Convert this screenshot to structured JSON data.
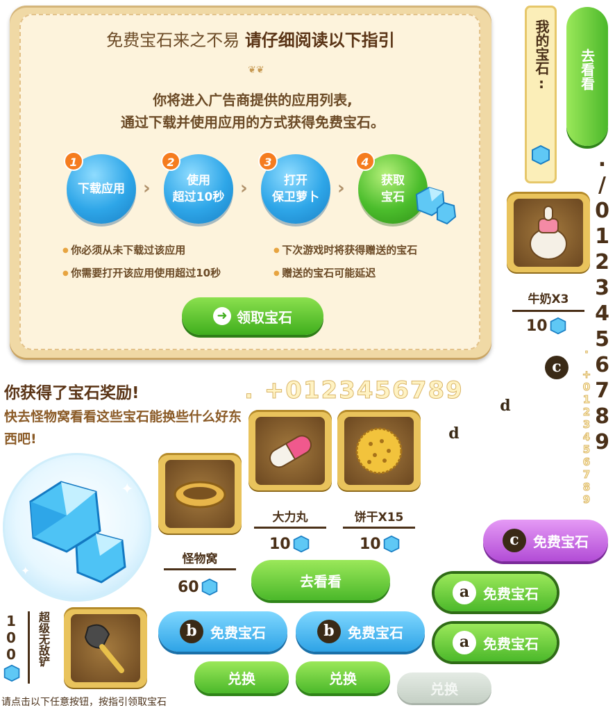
{
  "guide": {
    "title_normal": "免费宝石来之不易",
    "title_strong": "请仔细阅读以下指引",
    "intro_line1": "你将进入广告商提供的应用列表,",
    "intro_line2": "通过下载并使用应用的方式获得免费宝石。",
    "steps": [
      {
        "num": "1",
        "label": "下载应用"
      },
      {
        "num": "2",
        "label": "使用\n超过10秒"
      },
      {
        "num": "3",
        "label": "打开\n保卫萝卜"
      },
      {
        "num": "4",
        "label": "获取\n宝石"
      }
    ],
    "bullets_left": [
      "你必须从未下载过该应用",
      "你需要打开该应用使用超过10秒"
    ],
    "bullets_right": [
      "下次游戏时将获得赠送的宝石",
      "赠送的宝石可能延迟"
    ],
    "claim_button": "领取宝石"
  },
  "reward": {
    "title": "你获得了宝石奖励!",
    "subtitle": "快去怪物窝看看这些宝石能换些什么好东西吧!"
  },
  "my_gems_label": "我的宝石:",
  "go_look_button": "去看看",
  "digits_large": ". +0123456789",
  "digits_vertical": "./0123456789",
  "digits_vertical_small": ". +0123456789",
  "items": {
    "milk": {
      "name": "牛奶X3",
      "price": "10"
    },
    "pill": {
      "name": "大力丸",
      "price": "10"
    },
    "cookie": {
      "name": "饼干X15",
      "price": "10"
    },
    "nest": {
      "name": "怪物窝",
      "price": "60"
    },
    "shovel": {
      "name": "超级无敌铲",
      "price": "100"
    }
  },
  "buttons": {
    "free_gems": "免费宝石",
    "go_look_2": "去看看",
    "exchange": "兑换",
    "badge_a": "a",
    "badge_b": "b",
    "badge_c": "c",
    "badge_d": "d"
  },
  "footer_note": "请点击以下任意按钮，按指引领取宝石",
  "colors": {
    "accent_green": "#4bb82a",
    "accent_blue": "#2ea3e6",
    "accent_purple": "#b24cd6",
    "accent_red": "#e63a66",
    "panel": "#fdf3dc"
  }
}
